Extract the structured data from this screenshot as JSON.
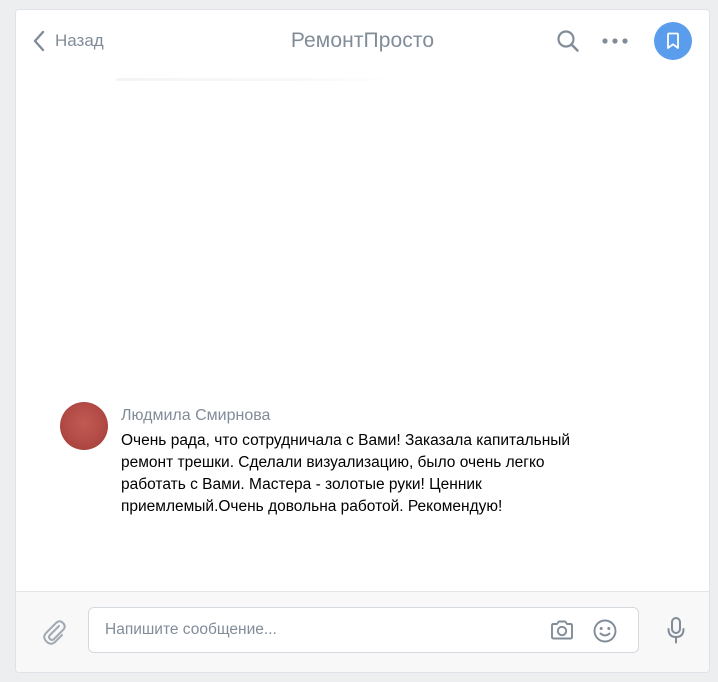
{
  "header": {
    "back_label": "Назад",
    "title": "РемонтПросто",
    "accent_color": "#5b9ded"
  },
  "icons": {
    "back": "chevron-left-icon",
    "search": "search-icon",
    "more": "more-icon",
    "bookmark": "bookmark-icon",
    "attach": "paperclip-icon",
    "camera": "camera-icon",
    "emoji": "smile-icon",
    "voice": "microphone-icon"
  },
  "message": {
    "author": "Людмила Смирнова",
    "text": "Очень рада, что сотрудничала с Вами! Заказала капитальный\nремонт трешки. Сделали визуализацию, было очень легко\nработать с Вами. Мастера - золотые руки! Ценник\nприемлемый.Очень довольна работой. Рекомендую!"
  },
  "composer": {
    "placeholder": "Напишите сообщение...",
    "value": ""
  }
}
